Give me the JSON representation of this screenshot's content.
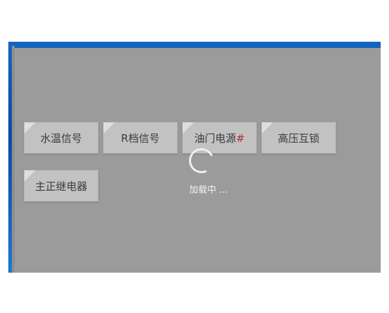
{
  "buttons": [
    {
      "label": "水温信号"
    },
    {
      "label": "R档信号"
    },
    {
      "label_main": "油门电源",
      "label_extra": "#"
    },
    {
      "label": "高压互锁"
    },
    {
      "label": "主正继电器"
    }
  ],
  "loading": {
    "text": "加载中 ..."
  },
  "colors": {
    "panel": "#9b9b9b",
    "button": "#c2c2c2",
    "desktop": "#1565c0"
  },
  "icons": {
    "spinner": "loading-spinner-icon"
  }
}
